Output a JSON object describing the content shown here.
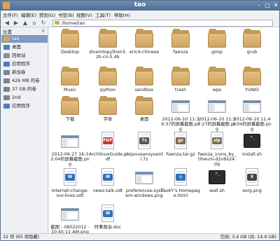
{
  "window": {
    "title": "tao"
  },
  "menu": [
    "文件(F)",
    "编辑(E)",
    "转到(G)",
    "书签(B)",
    "视图(V)",
    "工具(T)",
    "帮助(H)"
  ],
  "path": "/home/tao",
  "sidebar": {
    "header": "位置",
    "items": [
      {
        "label": "tao",
        "icon": "home-icon",
        "color": "#d9a650",
        "selected": true
      },
      {
        "label": "桌面",
        "icon": "desktop-icon",
        "color": "#5b7fb0"
      },
      {
        "label": "回收站",
        "icon": "trash-icon",
        "color": "#8a9096"
      },
      {
        "label": "应用程序",
        "icon": "apps-icon",
        "color": "#4f7cc4"
      },
      {
        "label": "新加卷",
        "icon": "drive-icon",
        "color": "#7d848c"
      },
      {
        "label": "426 MB 的卷",
        "icon": "drive-icon",
        "color": "#7d848c"
      },
      {
        "label": "37 GB 的卷",
        "icon": "drive-icon",
        "color": "#7d848c"
      },
      {
        "label": "2nd",
        "icon": "drive-icon",
        "color": "#7d848c"
      },
      {
        "label": "应用程序",
        "icon": "apps-icon",
        "color": "#4f7cc4"
      }
    ]
  },
  "files": [
    {
      "label": "Desktop",
      "kind": "folder"
    },
    {
      "label": "diveintopython3-zh-cn-5.4b",
      "kind": "folder"
    },
    {
      "label": "eric4-chinese",
      "kind": "folder"
    },
    {
      "label": "faenza",
      "kind": "folder"
    },
    {
      "label": "gimp",
      "kind": "folder"
    },
    {
      "label": "grub",
      "kind": "folder"
    },
    {
      "label": "Music",
      "kind": "folder"
    },
    {
      "label": "python",
      "kind": "folder"
    },
    {
      "label": "sandbox",
      "kind": "folder"
    },
    {
      "label": "trash",
      "kind": "folder"
    },
    {
      "label": "wps",
      "kind": "folder"
    },
    {
      "label": "YUNIO",
      "kind": "folder"
    },
    {
      "label": "下载",
      "kind": "folder"
    },
    {
      "label": "字体",
      "kind": "folder"
    },
    {
      "label": "桌面",
      "kind": "folder"
    },
    {
      "label": "2012-06-10 11:36:37的屏幕截图.png",
      "kind": "thumb"
    },
    {
      "label": "2012-06-10 11:37:27的屏幕截图.png",
      "kind": "thumb"
    },
    {
      "label": "2012-06-10 11:42:04的屏幕截图.png",
      "kind": "thumb"
    },
    {
      "label": "2012-06-27 16:32:04的屏幕截图.png",
      "kind": "thumb"
    },
    {
      "label": "ArchlinuxGuide.pdf",
      "kind": "file",
      "badge": "PDF",
      "color": "#c0392b"
    },
    {
      "label": "dejavusansyuanti.7z",
      "kind": "file",
      "badge": "7z",
      "color": "#555555"
    },
    {
      "label": "Faenza.tar.gz",
      "kind": "file",
      "badge": "gz",
      "color": "#7a6a4f"
    },
    {
      "label": "faenza_icons_by_tiheum-d2v6x24.zip",
      "kind": "file",
      "badge": "zip",
      "color": "#7a6a4f"
    },
    {
      "label": "install.sh",
      "kind": "term"
    },
    {
      "label": "Internet-change-our-lives.odt",
      "kind": "file",
      "badge": "W",
      "color": "#2f6fb8"
    },
    {
      "label": "news-talk.odt",
      "kind": "file",
      "badge": "W",
      "color": "#2f6fb8"
    },
    {
      "label": "preferences-system-windows.png",
      "kind": "thumb"
    },
    {
      "label": "TaoKY's Homepage.html",
      "kind": "file",
      "badge": "◎",
      "color": "#2f6fb8"
    },
    {
      "label": "wall.sh",
      "kind": "term"
    },
    {
      "label": "xorg.png",
      "kind": "file",
      "badge": "X",
      "color": "#444444"
    },
    {
      "label": "截图 - 08022012 - 10:45:11 AM.png",
      "kind": "thumb"
    },
    {
      "label": "时事政治.doc",
      "kind": "file",
      "badge": "W",
      "color": "#2f6fb8"
    }
  ],
  "status": {
    "left": "32 项 (65 项隐藏)",
    "right": "空闲: 3.4 GB (共: 14.9 GB)"
  }
}
